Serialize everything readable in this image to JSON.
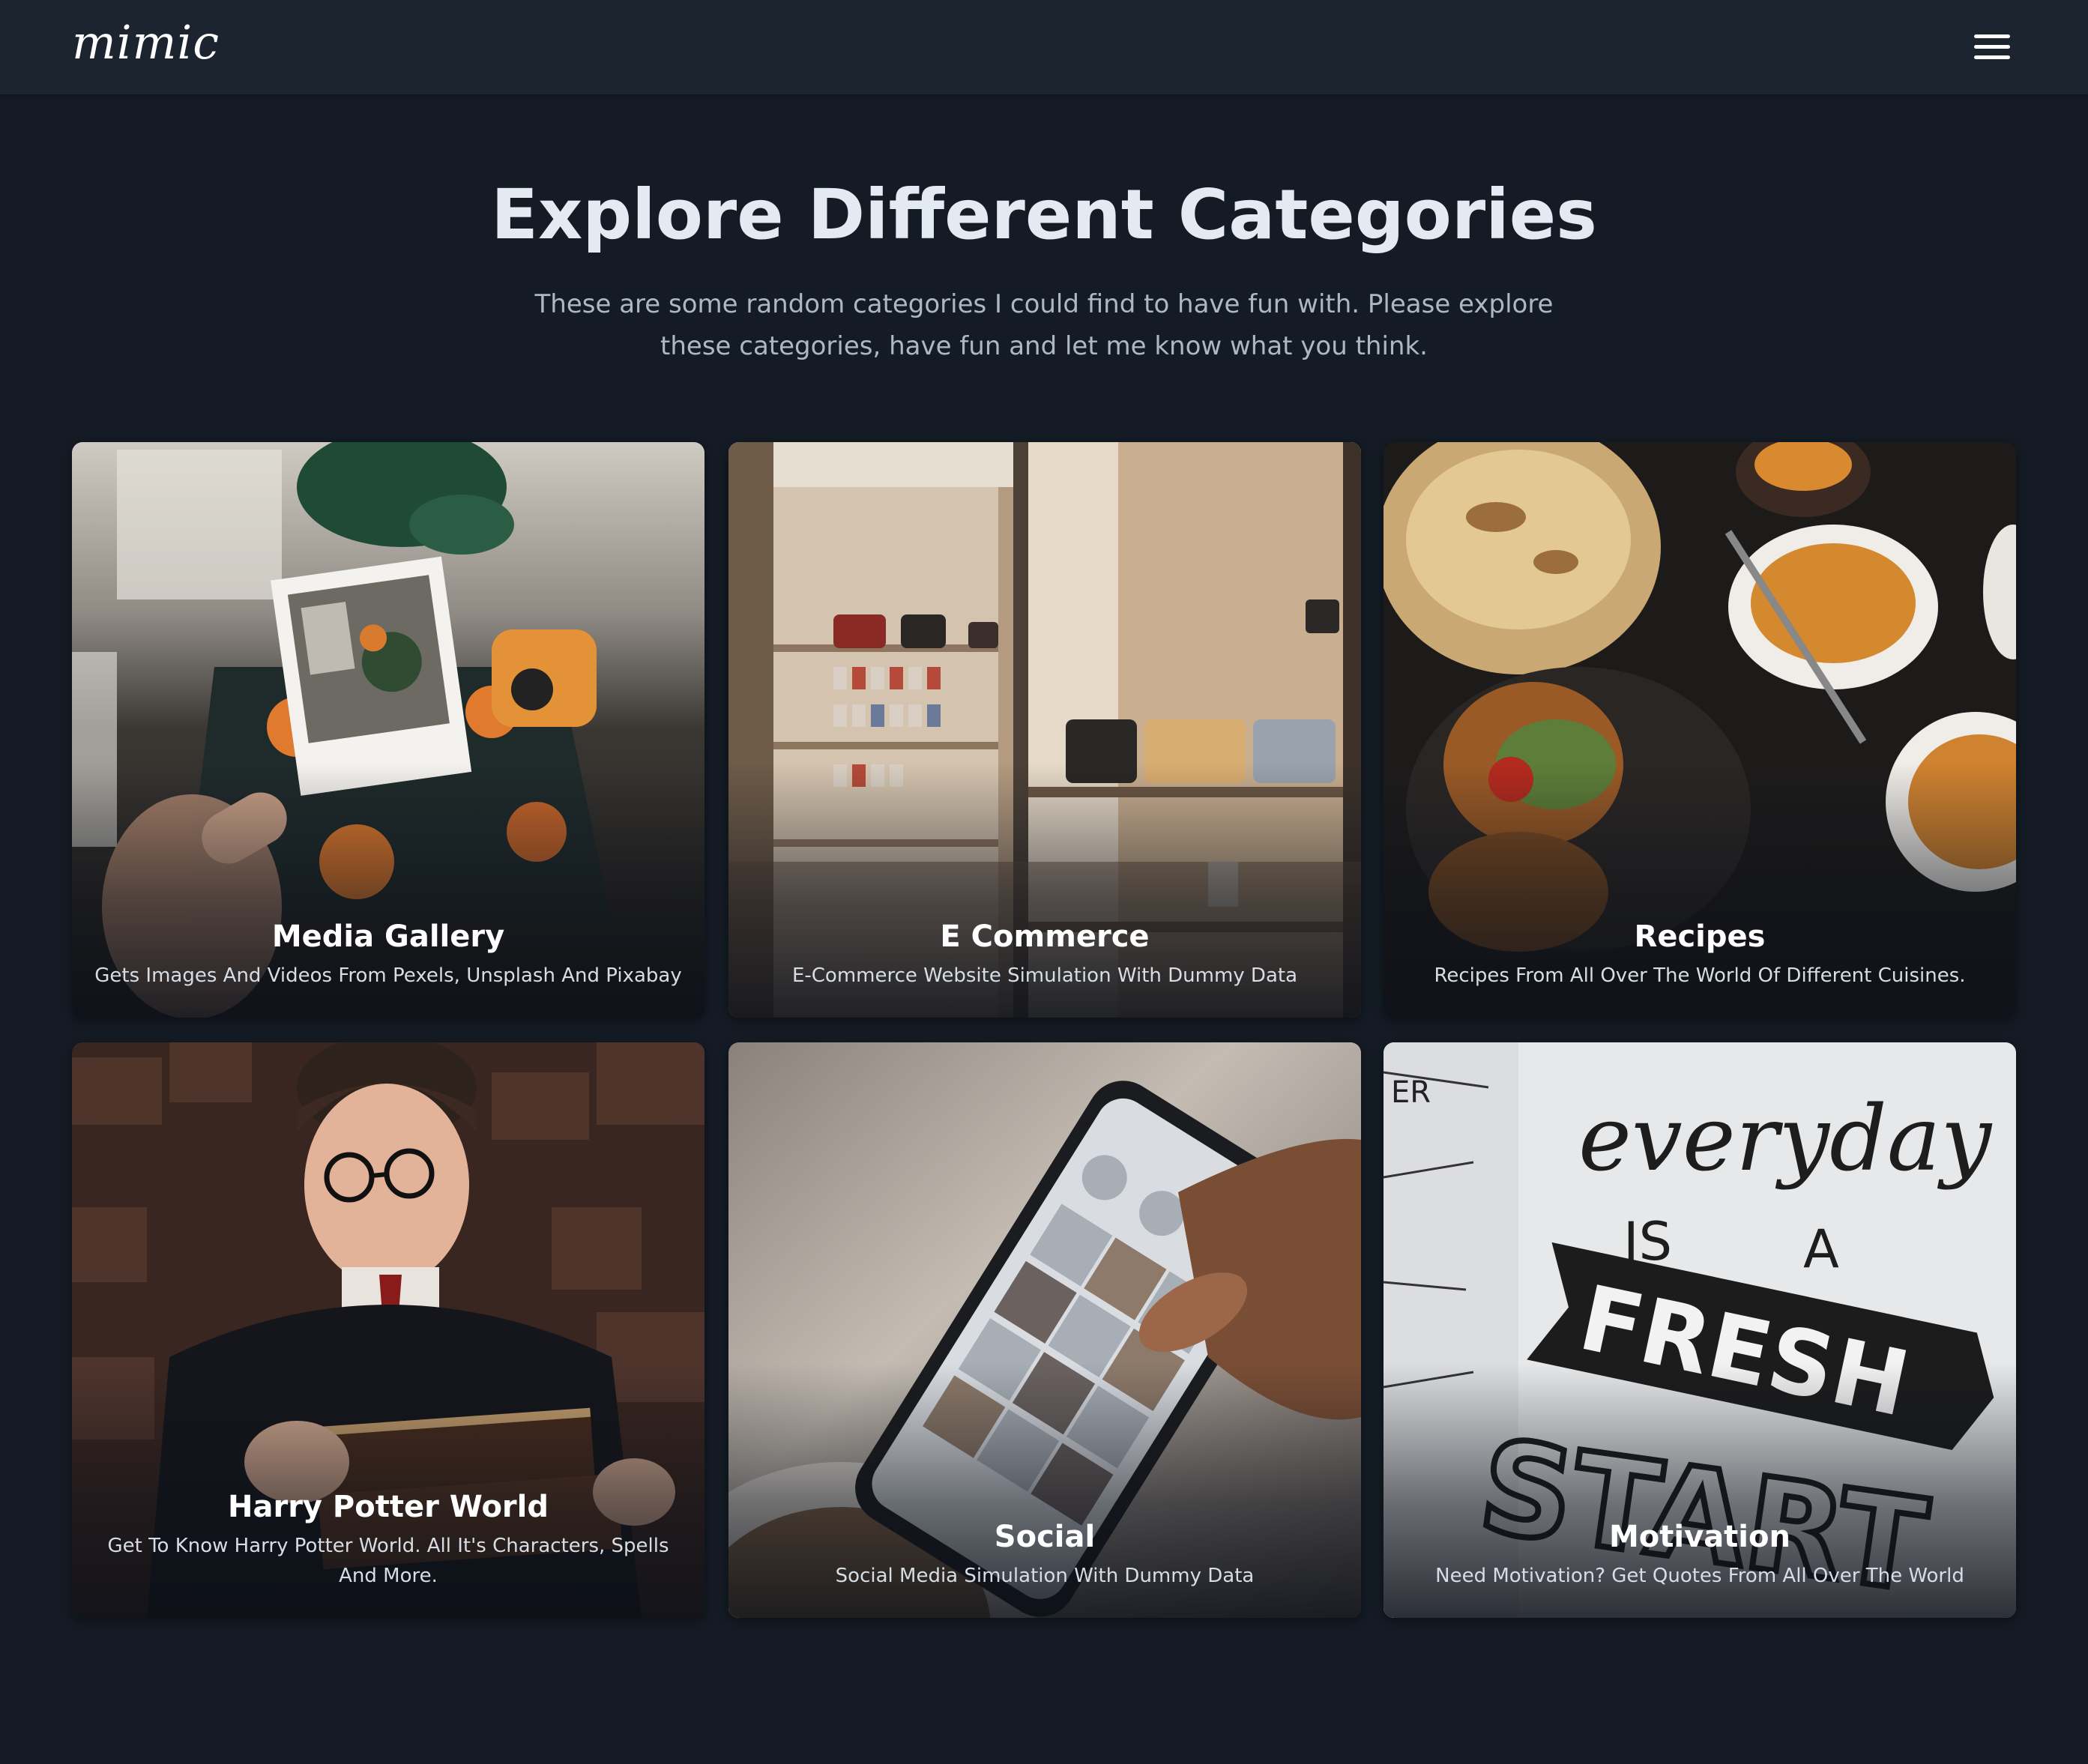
{
  "nav": {
    "logo": "mimic",
    "menu_icon": "hamburger-menu-icon"
  },
  "hero": {
    "title": "Explore Different Categories",
    "subtitle": "These are some random categories I could find to have fun with. Please explore these categories, have fun and let me know what you think."
  },
  "categories": [
    {
      "title": "Media Gallery",
      "description": "Gets Images And Videos From Pexels, Unsplash And Pixabay",
      "image": "instant-camera-photo-image"
    },
    {
      "title": "E Commerce",
      "description": "E-Commerce Website Simulation With Dummy Data",
      "image": "handbag-store-shelves-image"
    },
    {
      "title": "Recipes",
      "description": "Recipes From All Over The World Of Different Cuisines.",
      "image": "food-bowls-naan-image"
    },
    {
      "title": "Harry Potter World",
      "description": "Get To Know Harry Potter World. All It's Characters, Spells And More.",
      "image": "boy-wizard-books-image"
    },
    {
      "title": "Social",
      "description": "Social Media Simulation With Dummy Data",
      "image": "hand-holding-phone-image"
    },
    {
      "title": "Motivation",
      "description": "Need Motivation? Get Quotes From All Over The World",
      "image": "everyday-fresh-start-notebook-image"
    }
  ],
  "colors": {
    "page_bg": "#141b24",
    "navbar_bg": "#1c2430",
    "title": "#e3eaf2",
    "subtitle": "#aeb8c4"
  }
}
